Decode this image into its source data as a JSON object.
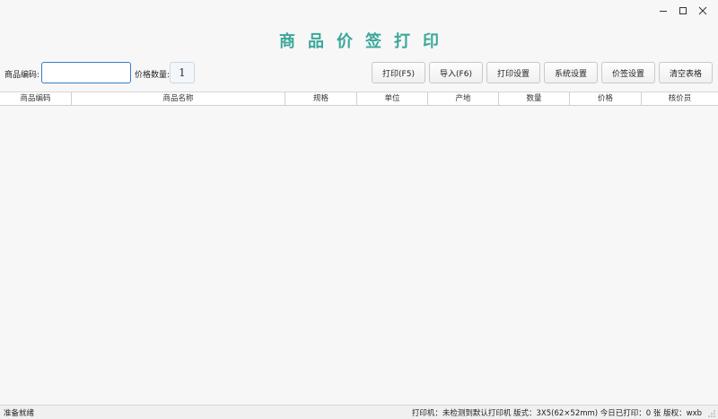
{
  "window": {
    "title": "商品价签打印",
    "controls": [
      "minimize-icon",
      "maximize-icon",
      "close-icon"
    ]
  },
  "toolbar": {
    "code_label": "商品编码:",
    "code_value": "",
    "qty_label": "价格数量:",
    "qty_value": "1",
    "buttons": [
      {
        "label": "打印(F5)"
      },
      {
        "label": "导入(F6)"
      },
      {
        "label": "打印设置"
      },
      {
        "label": "系统设置"
      },
      {
        "label": "价签设置"
      },
      {
        "label": "清空表格"
      }
    ]
  },
  "table": {
    "columns": [
      "商品编码",
      "商品名称",
      "规格",
      "单位",
      "产地",
      "数量",
      "价格",
      "核价员"
    ],
    "rows": []
  },
  "status": {
    "left": "准备就绪",
    "right": "打印机：未检测到默认打印机  版式：3X5(62×52mm)  今日已打印：0 张  版权：wxb"
  },
  "colors": {
    "title": "#3aa89a",
    "input_focus_border": "#3a7bc8"
  }
}
